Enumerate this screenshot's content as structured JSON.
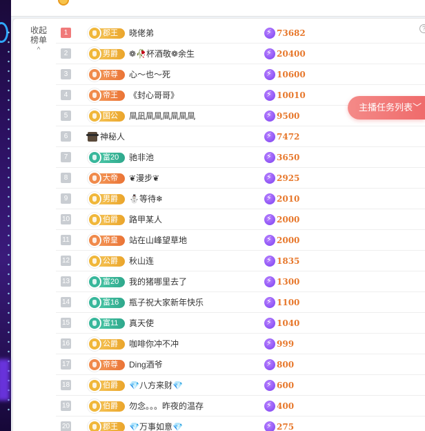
{
  "topbar": {
    "corner_text": "庆"
  },
  "panel": {
    "collapse_label_line1": "收起",
    "collapse_label_line2": "榜单",
    "collapse_chevron": "^",
    "info_glyph": "?"
  },
  "task_button_label": "主播任务列表",
  "task_button_chevron": "﹀",
  "rows": [
    {
      "rank": "1",
      "badge": "郡王",
      "color": "gold",
      "name": "晓佬弟",
      "score": "73682"
    },
    {
      "rank": "2",
      "badge": "男爵",
      "color": "gold",
      "name": "❁🥀杯酒敬❁余生",
      "score": "20400"
    },
    {
      "rank": "3",
      "badge": "帝尊",
      "color": "orange",
      "name": "心～也～死",
      "score": "10600"
    },
    {
      "rank": "4",
      "badge": "帝王",
      "color": "orange",
      "name": "《封心哥哥》",
      "score": "10010"
    },
    {
      "rank": "5",
      "badge": "国公",
      "color": "gold",
      "name": "凬凪凬凬凬凬凬凬",
      "score": "9500"
    },
    {
      "rank": "6",
      "badge": "",
      "color": "none",
      "name": "神秘人",
      "score": "7472"
    },
    {
      "rank": "7",
      "badge": "富20",
      "color": "teal",
      "name": "驰非池",
      "score": "3650"
    },
    {
      "rank": "8",
      "badge": "大帝",
      "color": "orange",
      "name": "❦漫步❦",
      "score": "2925"
    },
    {
      "rank": "9",
      "badge": "男爵",
      "color": "gold",
      "name": "⛄等待❄",
      "score": "2010"
    },
    {
      "rank": "10",
      "badge": "伯爵",
      "color": "gold",
      "name": "路甲某人",
      "score": "2000"
    },
    {
      "rank": "11",
      "badge": "帝皇",
      "color": "orange",
      "name": "站在山峰望草地",
      "score": "2000"
    },
    {
      "rank": "12",
      "badge": "公爵",
      "color": "gold",
      "name": "秋山连",
      "score": "1835"
    },
    {
      "rank": "13",
      "badge": "富20",
      "color": "teal",
      "name": "我的猪哪里去了",
      "score": "1300"
    },
    {
      "rank": "14",
      "badge": "富16",
      "color": "teal",
      "name": "瓶子祝大家新年快乐",
      "score": "1100"
    },
    {
      "rank": "15",
      "badge": "富11",
      "color": "teal",
      "name": "真天使",
      "score": "1040"
    },
    {
      "rank": "16",
      "badge": "公爵",
      "color": "gold",
      "name": "咖啡你冲不冲",
      "score": "999"
    },
    {
      "rank": "17",
      "badge": "帝尊",
      "color": "orange",
      "name": "Ding酒爷",
      "score": "800"
    },
    {
      "rank": "18",
      "badge": "伯爵",
      "color": "gold",
      "name": "💎八方来财💎",
      "score": "600"
    },
    {
      "rank": "19",
      "badge": "伯爵",
      "color": "gold",
      "name": "勿念。。。昨夜的温存",
      "score": "400"
    },
    {
      "rank": "20",
      "badge": "郡王",
      "color": "gold",
      "name": "💎万事如意💎",
      "score": "275"
    }
  ],
  "colors": {
    "rank_top": "#f07a7a",
    "rank_default": "#c9cdd2",
    "score": "#e7782c",
    "task_button": "#ef6b6b"
  }
}
